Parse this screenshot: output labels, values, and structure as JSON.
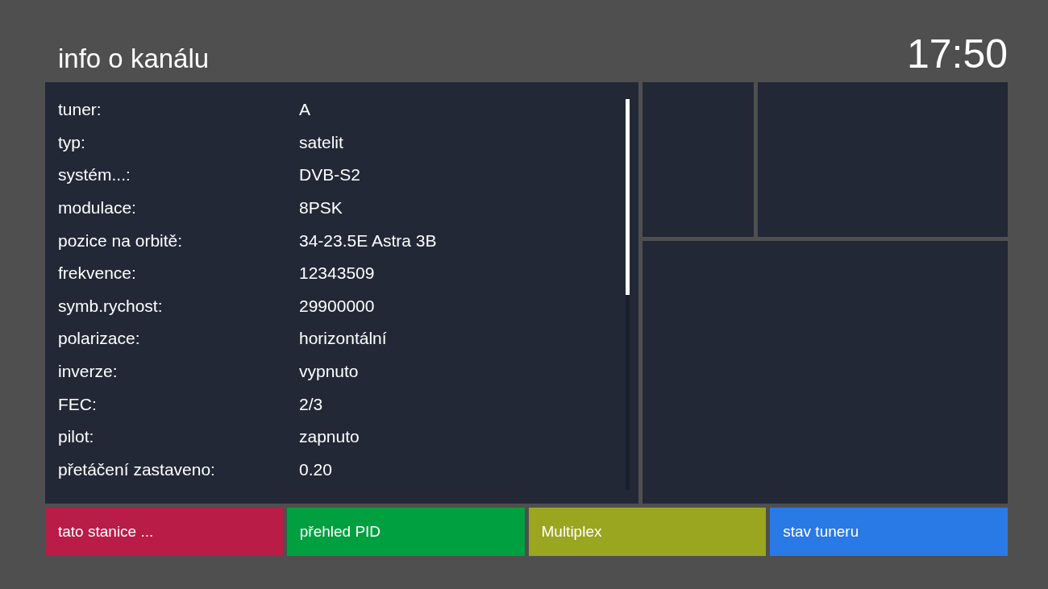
{
  "header": {
    "title": "info o kanálu",
    "time": "17:50"
  },
  "info_rows": [
    {
      "label": "tuner:",
      "value": "A"
    },
    {
      "label": "typ:",
      "value": "satelit"
    },
    {
      "label": "systém...:",
      "value": "DVB-S2"
    },
    {
      "label": "modulace:",
      "value": "8PSK"
    },
    {
      "label": "pozice na orbitě:",
      "value": "34-23.5E Astra 3B"
    },
    {
      "label": "frekvence:",
      "value": "12343509"
    },
    {
      "label": "symb.rychost:",
      "value": "29900000"
    },
    {
      "label": "polarizace:",
      "value": "horizontální"
    },
    {
      "label": "inverze:",
      "value": "vypnuto"
    },
    {
      "label": "FEC:",
      "value": "2/3"
    },
    {
      "label": "pilot:",
      "value": "zapnuto"
    },
    {
      "label": "přetáčení zastaveno:",
      "value": "0.20"
    }
  ],
  "color_buttons": [
    {
      "label": "tato stanice ...",
      "color": "#b91c47"
    },
    {
      "label": "přehled PID",
      "color": "#00a040"
    },
    {
      "label": "Multiplex",
      "color": "#9aa620"
    },
    {
      "label": "stav tuneru",
      "color": "#2979e6"
    }
  ]
}
